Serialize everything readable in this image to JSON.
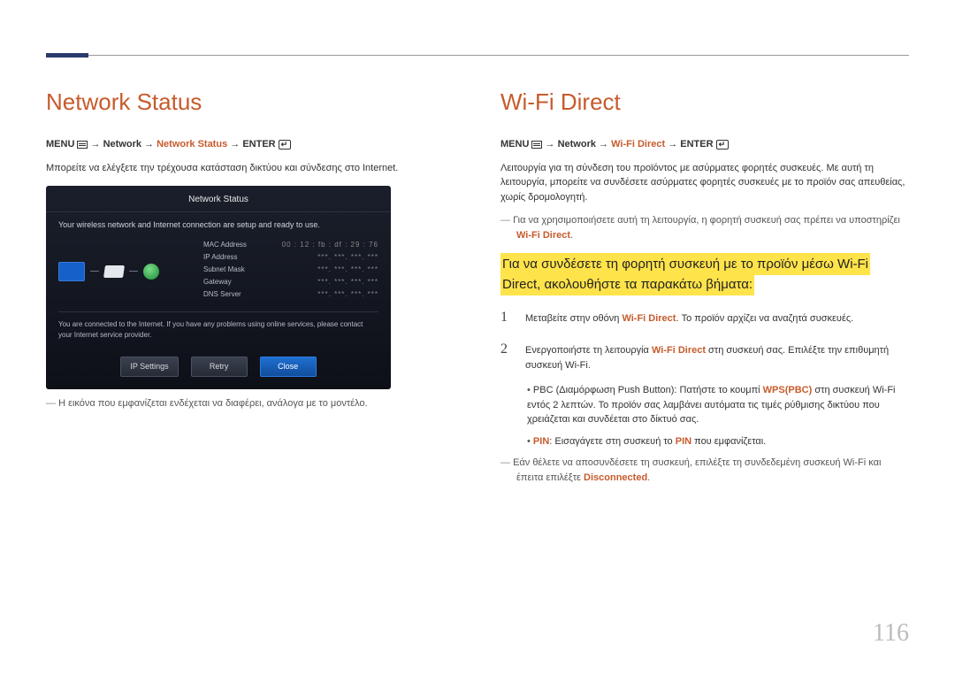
{
  "page_number": "116",
  "left": {
    "heading": "Network Status",
    "menu_prefix": "MENU",
    "menu_mid": "Network",
    "menu_item": "Network Status",
    "menu_enter": "ENTER",
    "arrow": "→",
    "body": "Μπορείτε να ελέγξετε την τρέχουσα κατάσταση δικτύου και σύνδεσης στο Internet.",
    "footnote": "Η εικόνα που εμφανίζεται ενδέχεται να διαφέρει, ανάλογα με το μοντέλο.",
    "shot": {
      "title": "Network Status",
      "msg1": "Your wireless network and Internet connection are setup and ready to use.",
      "rows": {
        "mac_k": "MAC Address",
        "mac_v": "00 : 12 : fb : df : 29 : 76",
        "ip_k": "IP Address",
        "ip_v": "***. ***. ***. ***",
        "sub_k": "Subnet Mask",
        "sub_v": "***. ***. ***. ***",
        "gw_k": "Gateway",
        "gw_v": "***. ***. ***. ***",
        "dns_k": "DNS Server",
        "dns_v": "***. ***. ***. ***"
      },
      "msg2": "You are connected to the Internet. If you have any problems using online services, please contact your Internet service provider.",
      "btn_ip": "IP Settings",
      "btn_retry": "Retry",
      "btn_close": "Close"
    }
  },
  "right": {
    "heading": "Wi-Fi Direct",
    "menu_prefix": "MENU",
    "menu_mid": "Network",
    "menu_item": "Wi-Fi Direct",
    "menu_enter": "ENTER",
    "arrow": "→",
    "body": "Λειτουργία για τη σύνδεση του προϊόντος με ασύρματες φορητές συσκευές. Με αυτή τη λειτουργία, μπορείτε να συνδέσετε ασύρματες φορητές συσκευές με το προϊόν σας απευθείας, χωρίς δρομολογητή.",
    "note1_a": "Για να χρησιμοποιήσετε αυτή τη λειτουργία, η φορητή συσκευή σας πρέπει να υποστηρίζει ",
    "note1_b": "Wi-Fi Direct",
    "note1_c": ".",
    "callout": "Για να συνδέσετε τη φορητή συσκευή με το προϊόν μέσω Wi-Fi Direct, ακολουθήστε τα παρακάτω βήματα:",
    "steps": {
      "s1_a": "Μεταβείτε στην οθόνη ",
      "s1_h": "Wi-Fi Direct",
      "s1_b": ". Το προϊόν αρχίζει να αναζητά συσκευές.",
      "s2_a": "Ενεργοποιήστε τη λειτουργία ",
      "s2_h": "Wi-Fi Direct",
      "s2_b": " στη συσκευή σας. Επιλέξτε την επιθυμητή συσκευή Wi-Fi."
    },
    "sub1_a": "PBC (Διαμόρφωση Push Button): Πατήστε το κουμπί ",
    "sub1_h": "WPS(PBC)",
    "sub1_b": " στη συσκευή Wi-Fi εντός 2 λεπτών. Το προϊόν σας λαμβάνει αυτόματα τις τιμές ρύθμισης δικτύου που χρειάζεται και συνδέεται στο δίκτυό σας.",
    "sub2_a": "PIN",
    "sub2_b": ": Εισαγάγετε στη συσκευή το ",
    "sub2_c": "PIN",
    "sub2_d": " που εμφανίζεται.",
    "note2_a": "Εάν θέλετε να αποσυνδέσετε τη συσκευή, επιλέξτε τη συνδεδεμένη συσκευή Wi-Fi και έπειτα επιλέξτε ",
    "note2_b": "Disconnected",
    "note2_c": "."
  }
}
